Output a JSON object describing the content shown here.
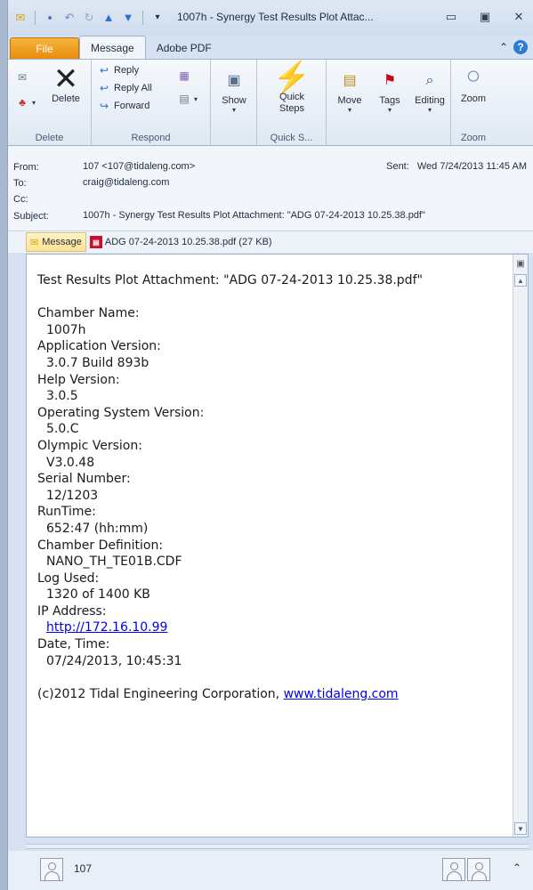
{
  "window": {
    "title": "1007h - Synergy Test Results Plot Attac...",
    "qat_icons": [
      "mail-icon",
      "save-icon",
      "undo-icon",
      "redo-icon",
      "up-arrow-icon",
      "down-arrow-icon",
      "customize-icon"
    ]
  },
  "tabs": [
    "File",
    "Message",
    "Adobe PDF"
  ],
  "ribbon": {
    "groups": {
      "delete": "Delete",
      "respond": "Respond",
      "quick_steps": "Quick S...",
      "zoom": "Zoom"
    },
    "buttons": {
      "delete": "Delete",
      "reply": "Reply",
      "reply_all": "Reply All",
      "forward": "Forward",
      "show": "Show",
      "quick_steps": "Quick Steps",
      "move": "Move",
      "tags": "Tags",
      "editing": "Editing",
      "zoom": "Zoom"
    }
  },
  "header": {
    "from_label": "From:",
    "from_value": "107 <107@tidaleng.com>",
    "to_label": "To:",
    "to_value": "craig@tidaleng.com",
    "cc_label": "Cc:",
    "cc_value": "",
    "subject_label": "Subject:",
    "subject_value": "1007h - Synergy Test Results Plot Attachment: \"ADG 07-24-2013 10.25.38.pdf\"",
    "sent_label": "Sent:",
    "sent_value": "Wed 7/24/2013 11:45 AM"
  },
  "attachments": {
    "message_tab": "Message",
    "file": "ADG 07-24-2013 10.25.38.pdf (27 KB)"
  },
  "body": {
    "intro": "Test Results Plot Attachment: \"ADG 07-24-2013 10.25.38.pdf\"",
    "fields": [
      {
        "label": "Chamber Name:",
        "value": "1007h"
      },
      {
        "label": "Application Version:",
        "value": "3.0.7 Build 893b"
      },
      {
        "label": "Help Version:",
        "value": "3.0.5"
      },
      {
        "label": "Operating System Version:",
        "value": "5.0.C"
      },
      {
        "label": "Olympic Version:",
        "value": "V3.0.48"
      },
      {
        "label": "Serial Number:",
        "value": "12/1203"
      },
      {
        "label": "RunTime:",
        "value": "652:47 (hh:mm)"
      },
      {
        "label": "Chamber Definition:",
        "value": "NANO_TH_TE01B.CDF"
      },
      {
        "label": "Log Used:",
        "value": "1320 of 1400 KB"
      },
      {
        "label": "IP Address:",
        "value": "http://172.16.10.99"
      },
      {
        "label": "Date, Time:",
        "value": "07/24/2013, 10:45:31"
      }
    ],
    "footer_text": "(c)2012 Tidal Engineering Corporation, ",
    "footer_link": "www.tidaleng.com"
  },
  "people_pane": {
    "name": "107"
  }
}
